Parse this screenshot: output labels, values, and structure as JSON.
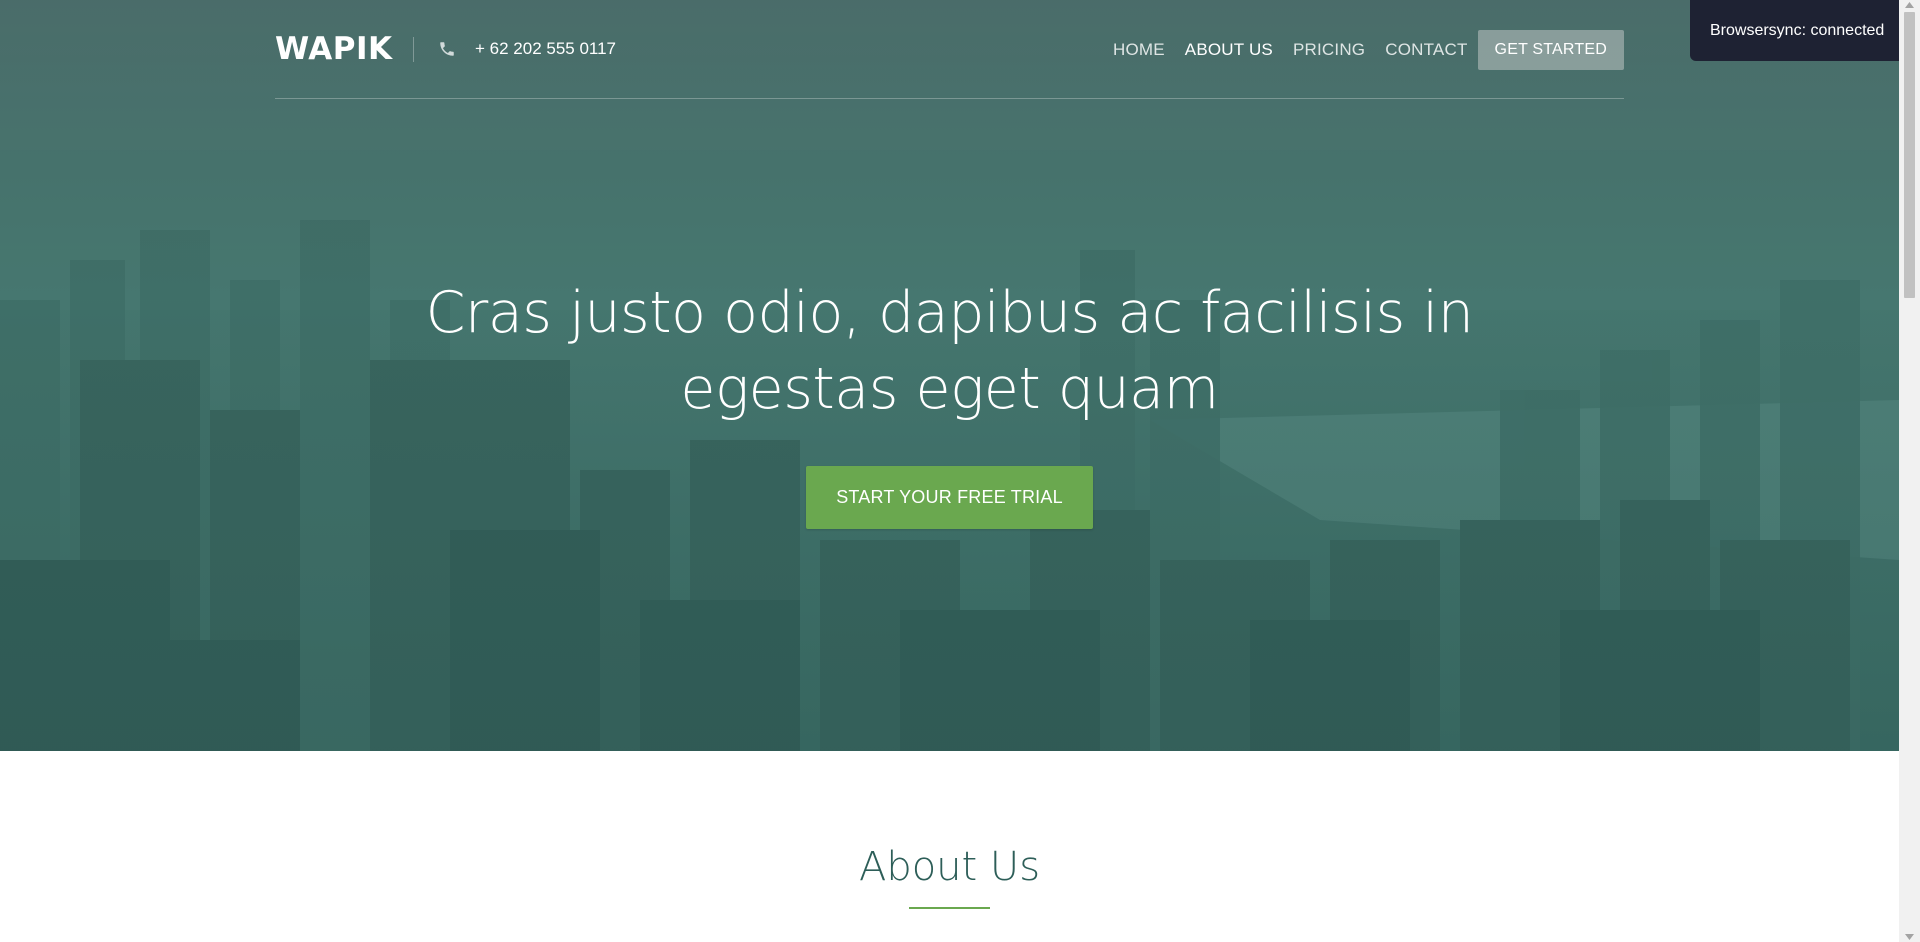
{
  "header": {
    "logo": "WAPIK",
    "phone": "+ 62 202 555 0117",
    "phone_icon": "phone-icon",
    "nav": [
      {
        "label": "HOME",
        "active": false
      },
      {
        "label": "ABOUT US",
        "active": true
      },
      {
        "label": "PRICING",
        "active": false
      },
      {
        "label": "CONTACT",
        "active": false
      }
    ],
    "cta_label": "GET STARTED"
  },
  "hero": {
    "headline_line1": "Cras justo odio, dapibus ac facilisis in",
    "headline_line2": "egestas eget quam",
    "button_label": "START YOUR FREE TRIAL",
    "button_color": "#6aa84f",
    "overlay_color": "#3f6c66"
  },
  "about": {
    "title": "About Us",
    "title_color": "#2d5e58",
    "underline_color": "#6aa84f"
  },
  "browsersync": {
    "message": "Browsersync: connected"
  }
}
